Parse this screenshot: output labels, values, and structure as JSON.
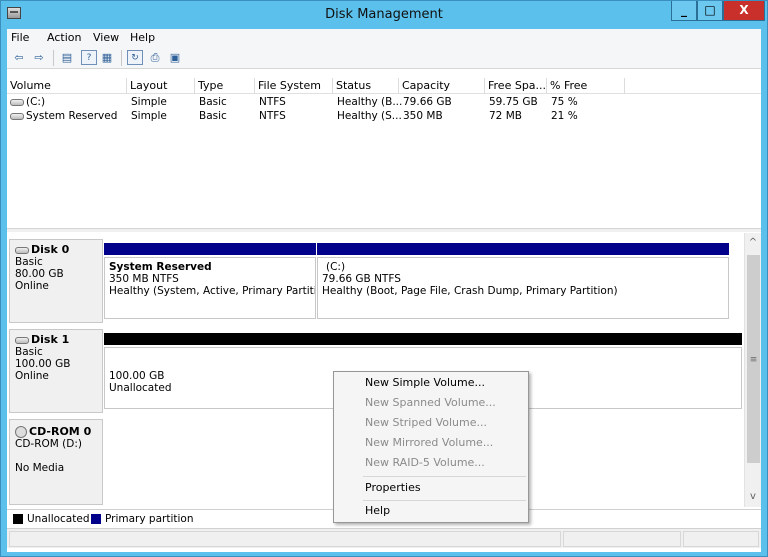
{
  "window": {
    "title": "Disk Management",
    "min": "_",
    "max": "□",
    "close": "X"
  },
  "menu": [
    "File",
    "Action",
    "View",
    "Help"
  ],
  "toolbar": {
    "back": "⇦",
    "forward": "⇨",
    "console_tree": "▤",
    "help": "?",
    "properties": "▦",
    "refresh": "↻",
    "export": "⎙",
    "rescan": "▣"
  },
  "volume_list": {
    "columns": [
      "Volume",
      "Layout",
      "Type",
      "File System",
      "Status",
      "Capacity",
      "Free Spa...",
      "% Free"
    ],
    "rows": [
      {
        "volume": "(C:)",
        "layout": "Simple",
        "type": "Basic",
        "fs": "NTFS",
        "status": "Healthy (B...",
        "capacity": "79.66 GB",
        "free": "59.75 GB",
        "pct": "75 %"
      },
      {
        "volume": "System Reserved",
        "layout": "Simple",
        "type": "Basic",
        "fs": "NTFS",
        "status": "Healthy (S...",
        "capacity": "350 MB",
        "free": "72 MB",
        "pct": "21 %"
      }
    ]
  },
  "disks": {
    "disk0": {
      "name": "Disk 0",
      "type": "Basic",
      "size": "80.00 GB",
      "state": "Online",
      "part1": {
        "name": "System Reserved",
        "size": "350 MB NTFS",
        "status": "Healthy (System, Active, Primary Partition"
      },
      "part2": {
        "name": "(C:)",
        "size": "79.66 GB NTFS",
        "status": "Healthy (Boot, Page File, Crash Dump, Primary Partition)"
      }
    },
    "disk1": {
      "name": "Disk 1",
      "type": "Basic",
      "size": "100.00 GB",
      "state": "Online",
      "unalloc_size": "100.00 GB",
      "unalloc_label": "Unallocated"
    },
    "cdrom": {
      "name": "CD-ROM 0",
      "drive": "CD-ROM (D:)",
      "media": "No Media"
    }
  },
  "legend": {
    "unallocated": "Unallocated",
    "primary": "Primary partition"
  },
  "colors": {
    "primary": "#00008b",
    "unallocated": "#000000",
    "titlebar": "#5bc0ec",
    "close": "#c9302c"
  },
  "context_menu": {
    "new_simple": "New Simple Volume...",
    "new_spanned": "New Spanned Volume...",
    "new_striped": "New Striped Volume...",
    "new_mirrored": "New Mirrored Volume...",
    "new_raid5": "New RAID-5 Volume...",
    "properties": "Properties",
    "help": "Help"
  },
  "scroll": {
    "up": "^",
    "down": "v",
    "grip": "≡"
  }
}
